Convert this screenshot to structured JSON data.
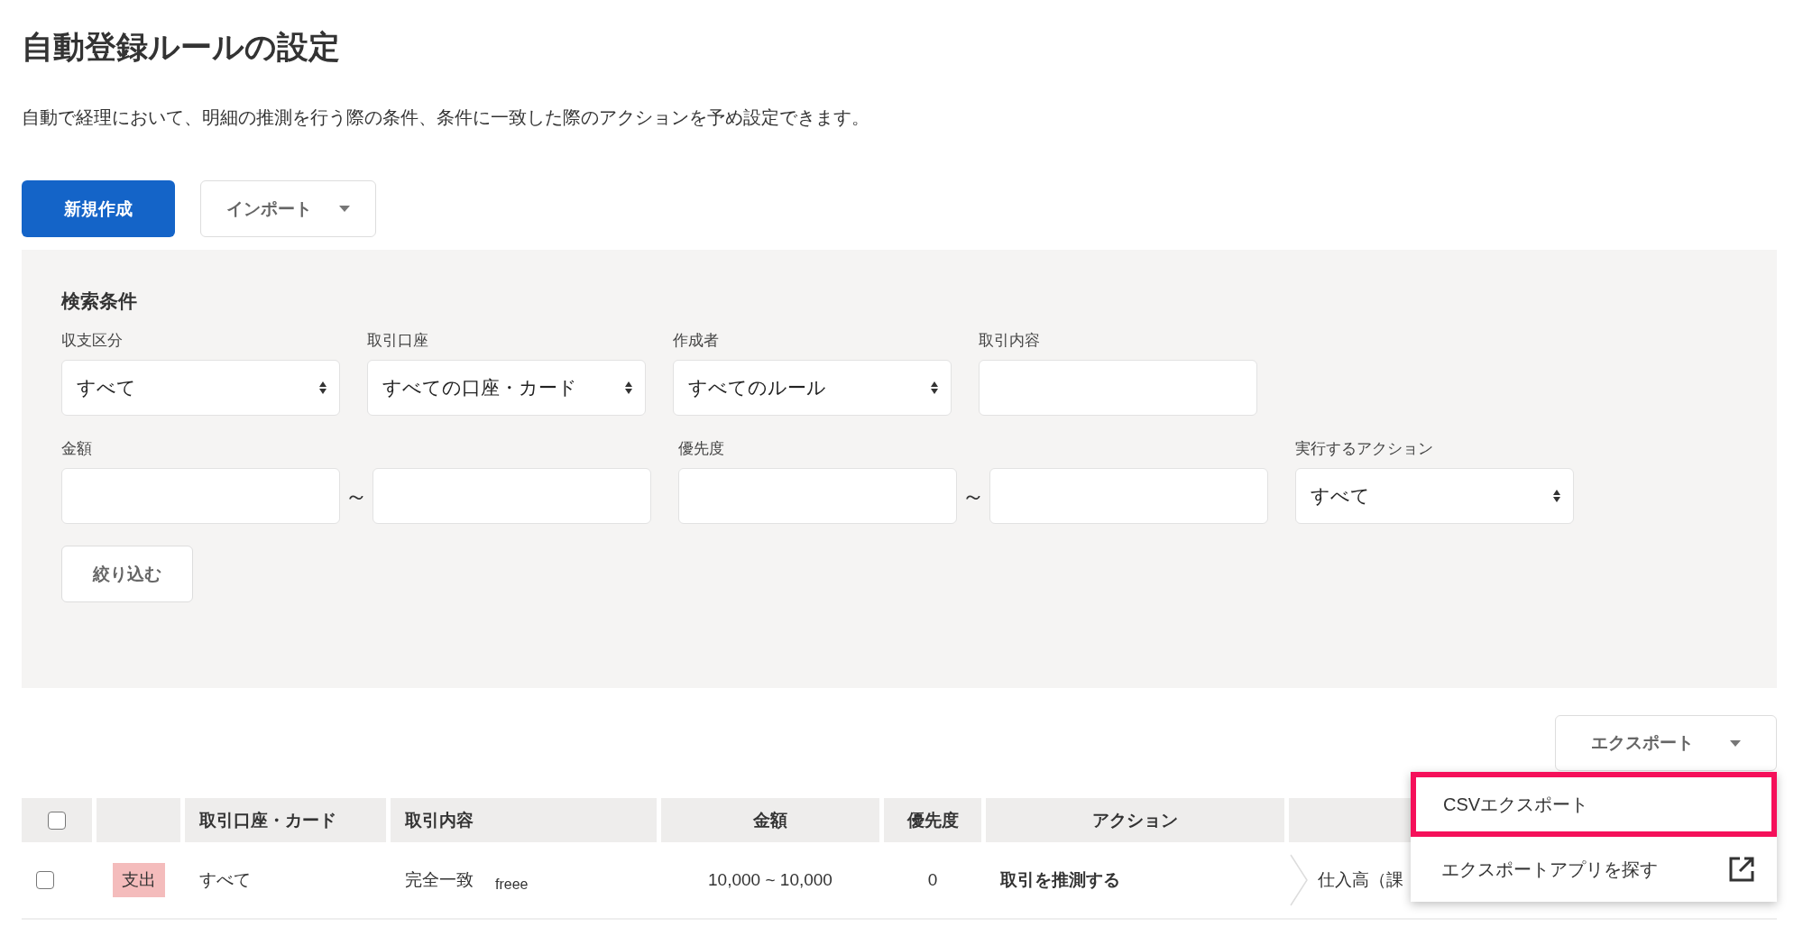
{
  "title": "自動登録ルールの設定",
  "description": "自動で経理において、明細の推測を行う際の条件、条件に一致した際のアクションを予め設定できます。",
  "toolbar": [
    {
      "label": "新規作成",
      "kind": "primary"
    },
    {
      "label": "インポート",
      "kind": "dropdown"
    }
  ],
  "search_panel": {
    "heading": "検索条件",
    "rows": [
      {
        "fields": [
          {
            "label": "収支区分",
            "kind": "select",
            "value": "すべて"
          },
          {
            "label": "取引口座",
            "kind": "select",
            "value": "すべての口座・カード"
          },
          {
            "label": "作成者",
            "kind": "select",
            "value": "すべてのルール"
          },
          {
            "label": "取引内容",
            "kind": "input"
          }
        ]
      },
      {
        "fields": [
          {
            "label": "金額",
            "kind": "range",
            "separator": "～"
          },
          {
            "label": "優先度",
            "kind": "range",
            "separator": "～"
          },
          {
            "label": "実行するアクション",
            "kind": "select",
            "value": "すべて"
          }
        ]
      }
    ],
    "filter_button": "絞り込む"
  },
  "export_button": "エクスポート",
  "export_menu": [
    {
      "label": "CSVエクスポート",
      "selected": true,
      "external": false
    },
    {
      "label": "エクスポートアプリを探す",
      "selected": false,
      "external": true
    }
  ],
  "table": {
    "select_all_checked": false,
    "columns": [
      "",
      "取引口座・カード",
      "取引内容",
      "金額",
      "優先度",
      "アクション",
      ""
    ],
    "rows": [
      {
        "checked": false,
        "type": "支出",
        "account": "すべて",
        "match": "完全一致",
        "text": "freee",
        "amount": "10,000 ~ 10,000",
        "priority": "0",
        "action": "取引を推測する",
        "result": "仕入高（課"
      }
    ]
  }
}
